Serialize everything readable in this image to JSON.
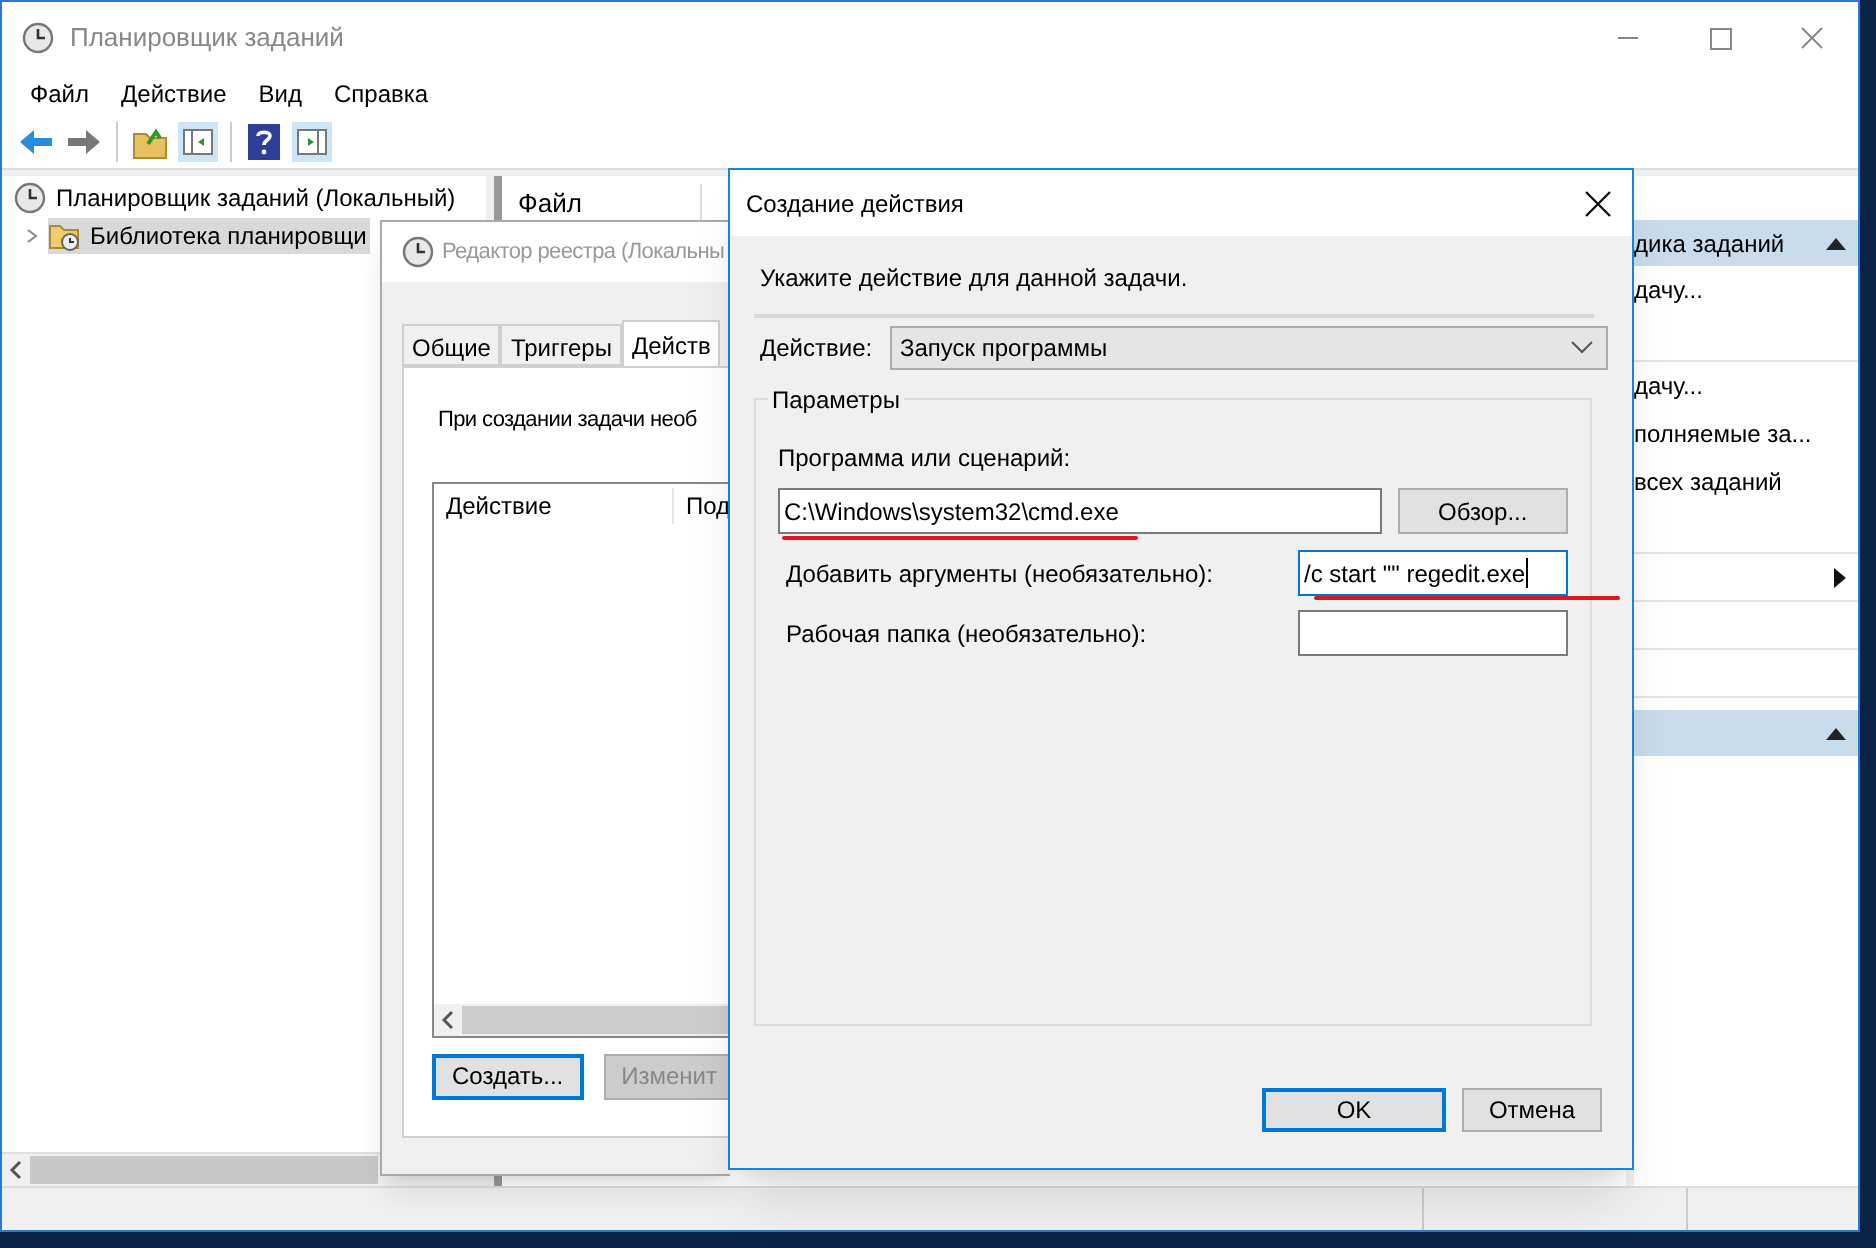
{
  "main_window": {
    "title": "Планировщик заданий",
    "menu": [
      "Файл",
      "Действие",
      "Вид",
      "Справка"
    ],
    "tree": [
      {
        "label": "Планировщик заданий (Локальный)",
        "selected": false,
        "children": [
          {
            "label": "Библиотека планировщи",
            "selected": true,
            "expanded": false
          }
        ]
      }
    ],
    "center_pane": {
      "columns": [
        "Файл"
      ]
    },
    "actions_pane": {
      "sections": [
        {
          "title": "дика заданий",
          "expanded": true,
          "items": [
            {
              "kind": "link",
              "label": "дачу..."
            },
            {
              "kind": "blank"
            },
            {
              "kind": "link",
              "label": "дачу..."
            },
            {
              "kind": "link",
              "label": "полняемые за..."
            },
            {
              "kind": "link",
              "label": "всех заданий"
            },
            {
              "kind": "blank"
            },
            {
              "kind": "submenu"
            },
            {
              "kind": "blank"
            },
            {
              "kind": "blank"
            }
          ]
        },
        {
          "expanded": true
        }
      ]
    }
  },
  "properties_window": {
    "title": "Редактор реестра (Локальны",
    "tabs": [
      {
        "label": "Общие",
        "selected": false
      },
      {
        "label": "Триггеры",
        "selected": false
      },
      {
        "label": "Действ",
        "selected": true
      }
    ],
    "description": "При создании задачи необ",
    "list_columns": [
      "Действие",
      "Под"
    ],
    "buttons": [
      {
        "label": "Создать...",
        "default": true,
        "disabled": false
      },
      {
        "label": "Изменит",
        "default": false,
        "disabled": true
      }
    ]
  },
  "dialog": {
    "title": "Создание действия",
    "prompt": "Укажите действие для данной задачи.",
    "action_label": "Действие:",
    "action_value": "Запуск программы",
    "group_title": "Параметры",
    "program_label": "Программа или сценарий:",
    "program_value": "C:\\Windows\\system32\\cmd.exe",
    "browse_button": "Обзор...",
    "arguments_label": "Добавить аргументы (необязательно):",
    "arguments_value": "/c start \"\" regedit.exe",
    "arguments_focused": true,
    "workdir_label": "Рабочая папка (необязательно):",
    "buttons": [
      {
        "label": "OK",
        "default": true
      },
      {
        "label": "Отмена",
        "default": false
      }
    ]
  }
}
